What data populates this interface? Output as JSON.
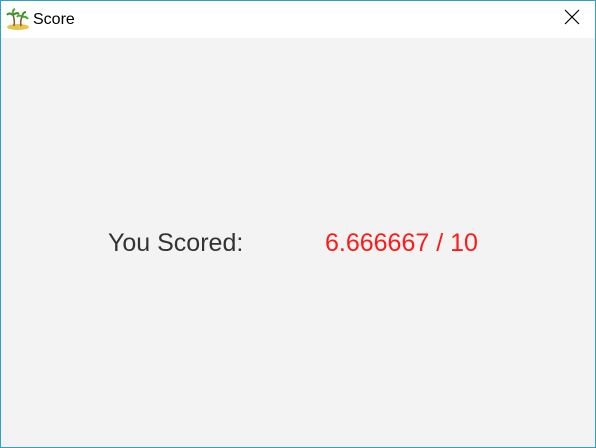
{
  "window": {
    "title": "Score",
    "icon": "palm-tree-island-icon"
  },
  "titlebar": {
    "close_icon": "close-icon"
  },
  "result": {
    "label": "You Scored:",
    "score_text": "6.666667 / 10",
    "score_color": "#ff1a1a"
  },
  "colors": {
    "window_border": "#2f9fd0",
    "content_background": "#f3f3f3",
    "titlebar_background": "#ffffff",
    "label_text": "#333333"
  }
}
